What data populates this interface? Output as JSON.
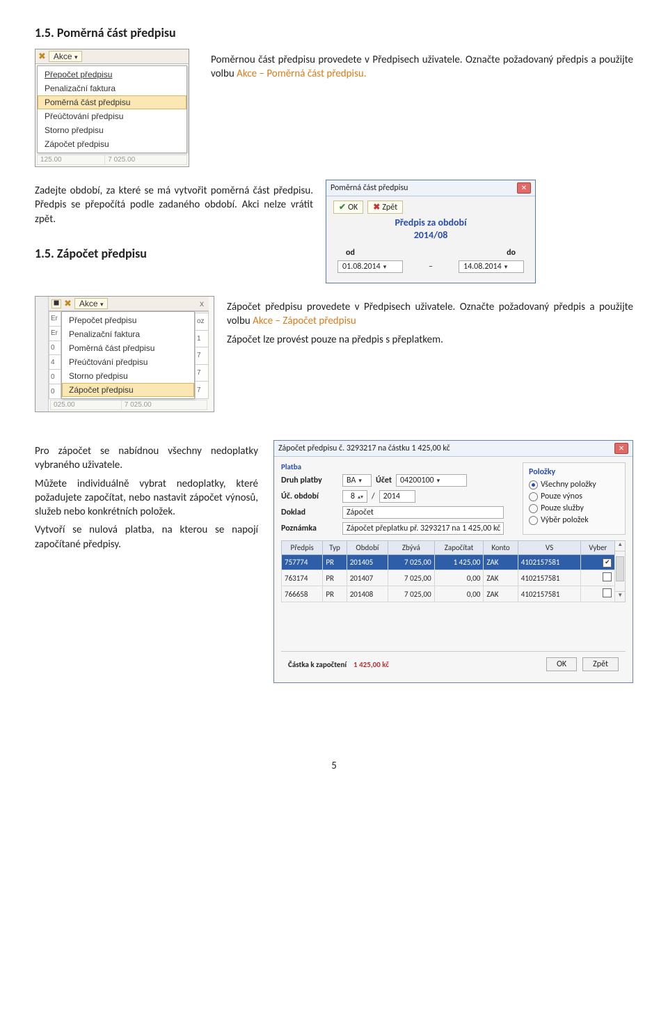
{
  "section15": {
    "title": "1.5. Poměrná část předpisu",
    "para1_prefix": "Poměrnou část předpisu provedete v Předpisech uživatele. Označte požadovaný předpis a použijte volbu ",
    "orange1": "Akce – Poměrná část předpisu.",
    "para2": "Zadejte období, za které se má vytvořit poměrná část předpisu. Předpis se přepočítá podle zadaného období. Akci nelze vrátit zpět.",
    "title_sub": "1.5. Zápočet předpisu",
    "para3_prefix": "Zápočet předpisu provedete v Předpisech uživatele. Označte požadovaný předpis a použijte volbu ",
    "orange2": "Akce – Zápočet předpisu",
    "para4": "Zápočet lze provést pouze na předpis s přeplatkem.",
    "para5": "Pro zápočet se nabídnou všechny nedoplatky vybraného uživatele.",
    "para6": "Můžete individuálně vybrat nedoplatky, které požadujete započítat, nebo nastavit zápočet výnosů, služeb nebo konkrétních položek.",
    "para7": "Vytvoří se nulová platba, na kterou se napojí započítané předpisy."
  },
  "menu1": {
    "akce": "Akce",
    "items": [
      "Přepočet předpisu",
      "Penalizační faktura",
      "Poměrná část předpisu",
      "Přeúčtování předpisu",
      "Storno předpisu",
      "Zápočet předpisu"
    ],
    "bottom_left": "125.00",
    "bottom_right": "7 025.00"
  },
  "menu2": {
    "akce": "Akce",
    "close_x": "x",
    "left_nums": [
      "Er",
      "Er",
      "0",
      "4",
      "0",
      "0",
      "025.00"
    ],
    "right_suffix": [
      "",
      "oz",
      "1",
      "7",
      "7",
      "7",
      "7 025.00"
    ],
    "items": [
      "Přepočet předpisu",
      "Penalizační faktura",
      "Poměrná část předpisu",
      "Přeúčtování předpisu",
      "Storno předpisu",
      "Zápočet předpisu"
    ]
  },
  "period_dialog": {
    "title": "Poměrná část předpisu",
    "ok": "OK",
    "back": "Zpět",
    "heading_line1": "Předpis za období",
    "heading_line2": "2014/08",
    "od": "od",
    "do": "do",
    "from": "01.08.2014",
    "to": "14.08.2014"
  },
  "offset_dialog": {
    "title": "Zápočet předpisu č. 3293217 na částku 1 425,00 kč",
    "platba": "Platba",
    "druh_platby_label": "Druh platby",
    "druh_platby_val": "BA",
    "ucet_label": "Účet",
    "ucet_val": "04200100",
    "uc_obdobi_label": "Úč. období",
    "uc_obdobi_m": "8",
    "uc_obdobi_y": "2014",
    "doklad_label": "Doklad",
    "doklad_val": "Zápočet",
    "poznamka_label": "Poznámka",
    "poznamka_val": "Zápočet přeplatku př. 3293217 na 1 425,00 kč",
    "polozky_title": "Položky",
    "radio1": "Všechny položky",
    "radio2": "Pouze výnos",
    "radio3": "Pouze služby",
    "radio4": "Výběr položek",
    "cols": [
      "Předpis",
      "Typ",
      "Období",
      "Zbývá",
      "Započítat",
      "Konto",
      "VS",
      "Vyber"
    ],
    "rows": [
      {
        "predpis": "757774",
        "typ": "PR",
        "obdobi": "201405",
        "zbyva": "7 025,00",
        "zap": "1 425,00",
        "konto": "ZAK",
        "vs": "4102157581",
        "vyber": true
      },
      {
        "predpis": "763174",
        "typ": "PR",
        "obdobi": "201407",
        "zbyva": "7 025,00",
        "zap": "0,00",
        "konto": "ZAK",
        "vs": "4102157581",
        "vyber": false
      },
      {
        "predpis": "766658",
        "typ": "PR",
        "obdobi": "201408",
        "zbyva": "7 025,00",
        "zap": "0,00",
        "konto": "ZAK",
        "vs": "4102157581",
        "vyber": false
      }
    ],
    "footer_label": "Částka k započtení",
    "footer_amount": "1 425,00 kč",
    "ok_btn": "OK",
    "back_btn": "Zpět"
  },
  "page_number": "5"
}
